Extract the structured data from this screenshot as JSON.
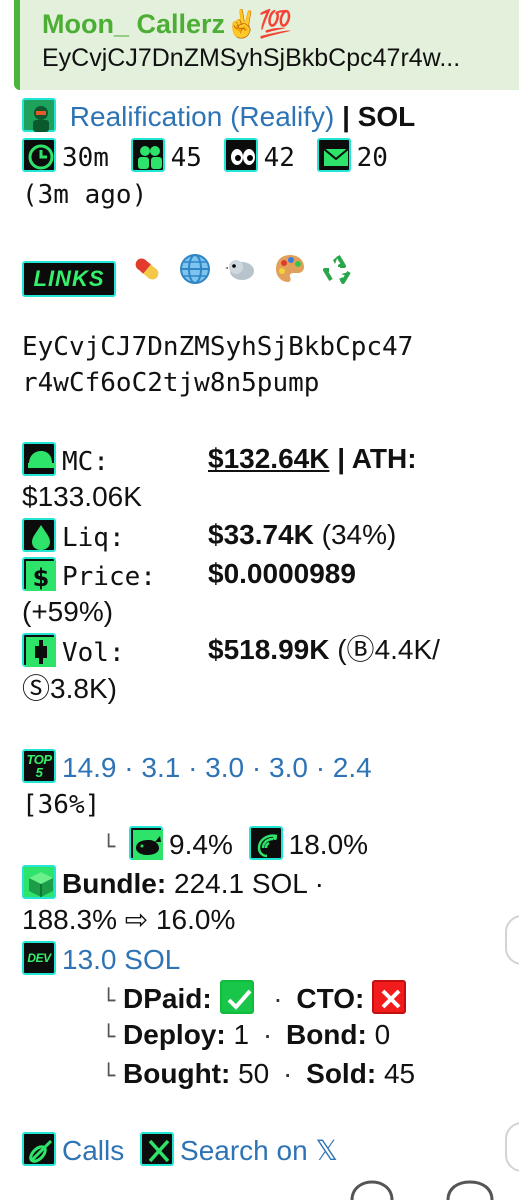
{
  "reply": {
    "name": "Moon_ Callerz✌️💯",
    "address": "EyCvjCJ7DnZMSyhSjBkbCpc47r4w..."
  },
  "token": {
    "name": "Realification (Realify)",
    "chain": "| SOL"
  },
  "stats": {
    "age": "30m",
    "holders": "45",
    "views": "42",
    "mail": "20",
    "ago": "(3m ago)"
  },
  "links": {
    "badge": "LINKS",
    "icons": [
      "pill-icon",
      "globe-icon",
      "bird-icon",
      "palette-icon",
      "recycle-icon"
    ]
  },
  "contract": {
    "line1": "EyCvjCJ7DnZMSyhSjBkbCpc47",
    "line2": "r4wCf6oC2tjw8n5pump"
  },
  "market": {
    "mc_label": "MC:",
    "mc_value": "$132.64K",
    "ath_label": "| ATH:",
    "ath_value": "$133.06K",
    "liq_label": "Liq:",
    "liq_value": "$33.74K",
    "liq_pct": "(34%)",
    "price_label": "Price:",
    "price_value": "$0.0000989",
    "price_change": "(+59%)",
    "vol_label": "Vol:",
    "vol_value": "$518.99K",
    "vol_open": "(",
    "vol_buy_mark": "Ⓑ",
    "vol_buy": "4.4K/",
    "vol_sell_mark": "Ⓢ",
    "vol_sell": "3.8K)"
  },
  "top": {
    "badge_line1": "TOP",
    "badge_line2": "5",
    "values": "14.9 · 3.1 · 3.0 · 3.0 · 2.4",
    "total": "[36%]",
    "whale_pct": "9.4%",
    "shrimp_pct": "18.0%"
  },
  "bundle": {
    "label": "Bundle:",
    "value": "224.1 SOL ·",
    "change": "188.3% ⇨ 16.0%"
  },
  "dev": {
    "badge": "DEV",
    "value": "13.0 SOL",
    "dpaid_label": "DPaid:",
    "cto_label": "CTO:",
    "deploy_label": "Deploy:",
    "deploy_value": "1",
    "bond_label": "Bond:",
    "bond_value": "0",
    "bought_label": "Bought:",
    "bought_value": "50",
    "sold_label": "Sold:",
    "sold_value": "45"
  },
  "footer": {
    "calls": "Calls",
    "search": "Search on 𝕏"
  },
  "colors": {
    "link": "#2e74b5",
    "accent_green": "#4cae34",
    "badge_border": "#23e5d4"
  }
}
